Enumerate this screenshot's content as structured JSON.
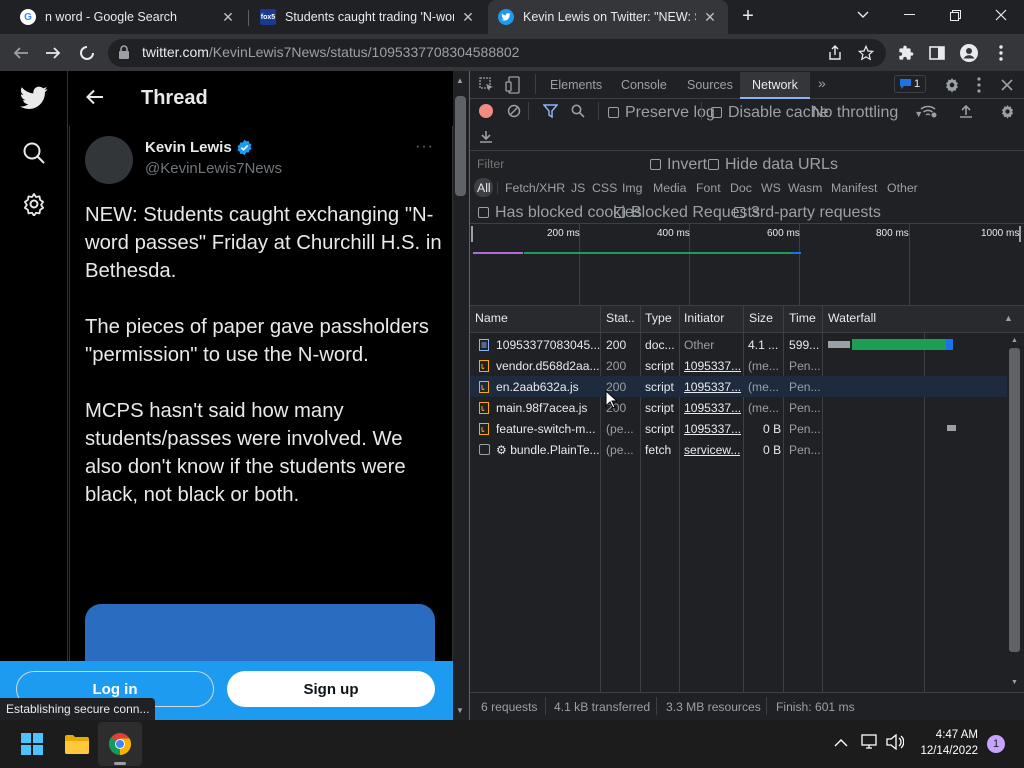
{
  "browser": {
    "tabs": [
      {
        "title": "n word - Google Search",
        "favicon": "G",
        "active": false
      },
      {
        "title": "Students caught trading 'N-word",
        "favicon": "fox5",
        "active": false
      },
      {
        "title": "Kevin Lewis on Twitter: \"NEW: Stu",
        "favicon": "twitter",
        "active": true
      }
    ],
    "new_tab": "+",
    "url_domain": "twitter.com",
    "url_path": "/KevinLewis7News/status/1095337708304588802"
  },
  "twitter": {
    "header_title": "Thread",
    "author_name": "Kevin Lewis",
    "author_handle": "@KevinLewis7News",
    "more": "···",
    "tweet_p1": "NEW: Students caught exchanging \"N-word passes\" Friday at Churchill H.S. in Bethesda.",
    "tweet_p2": "The pieces of paper gave passholders \"permission\" to use the N-word.",
    "tweet_p3": "MCPS hasn't said how many students/passes were involved. We also don't know if the students were black, not black or both.",
    "login_label": "Log in",
    "signup_label": "Sign up",
    "status_text": "Establishing secure conn..."
  },
  "devtools": {
    "tabs": [
      "Elements",
      "Console",
      "Sources",
      "Network"
    ],
    "active_tab": "Network",
    "issues_count": "1",
    "preserve_log": "Preserve log",
    "disable_cache": "Disable cache",
    "throttling": "No throttling",
    "filter_placeholder": "Filter",
    "invert": "Invert",
    "hide_data_urls": "Hide data URLs",
    "type_filters": [
      "All",
      "Fetch/XHR",
      "JS",
      "CSS",
      "Img",
      "Media",
      "Font",
      "Doc",
      "WS",
      "Wasm",
      "Manifest",
      "Other"
    ],
    "has_blocked_cookies": "Has blocked cookies",
    "blocked_requests": "Blocked Requests",
    "third_party": "3rd-party requests",
    "timeline_ticks": [
      "200 ms",
      "400 ms",
      "600 ms",
      "800 ms",
      "1000 ms"
    ],
    "columns": [
      "Name",
      "Stat..",
      "Type",
      "Initiator",
      "Size",
      "Time",
      "Waterfall"
    ],
    "rows": [
      {
        "name": "10953377083045...",
        "status": "200",
        "type": "doc...",
        "initiator": "Other",
        "size": "4.1 ...",
        "time": "599..."
      },
      {
        "name": "vendor.d568d2aa...",
        "status": "200",
        "type": "script",
        "initiator": "1095337...",
        "size": "(me...",
        "time": "Pen..."
      },
      {
        "name": "en.2aab632a.js",
        "status": "200",
        "type": "script",
        "initiator": "1095337...",
        "size": "(me...",
        "time": "Pen..."
      },
      {
        "name": "main.98f7acea.js",
        "status": "200",
        "type": "script",
        "initiator": "1095337...",
        "size": "(me...",
        "time": "Pen..."
      },
      {
        "name": "feature-switch-m...",
        "status": "(pe...",
        "type": "script",
        "initiator": "1095337...",
        "size": "0 B",
        "time": "Pen..."
      },
      {
        "name": "⚙ bundle.PlainTe...",
        "status": "(pe...",
        "type": "fetch",
        "initiator": "servicew...",
        "size": "0 B",
        "time": "Pen..."
      }
    ],
    "footer": {
      "requests": "6 requests",
      "transferred": "4.1 kB transferred",
      "resources": "3.3 MB resources",
      "finish": "Finish: 601 ms"
    }
  },
  "taskbar": {
    "time": "4:47 AM",
    "date": "12/14/2022",
    "notification_count": "1"
  }
}
